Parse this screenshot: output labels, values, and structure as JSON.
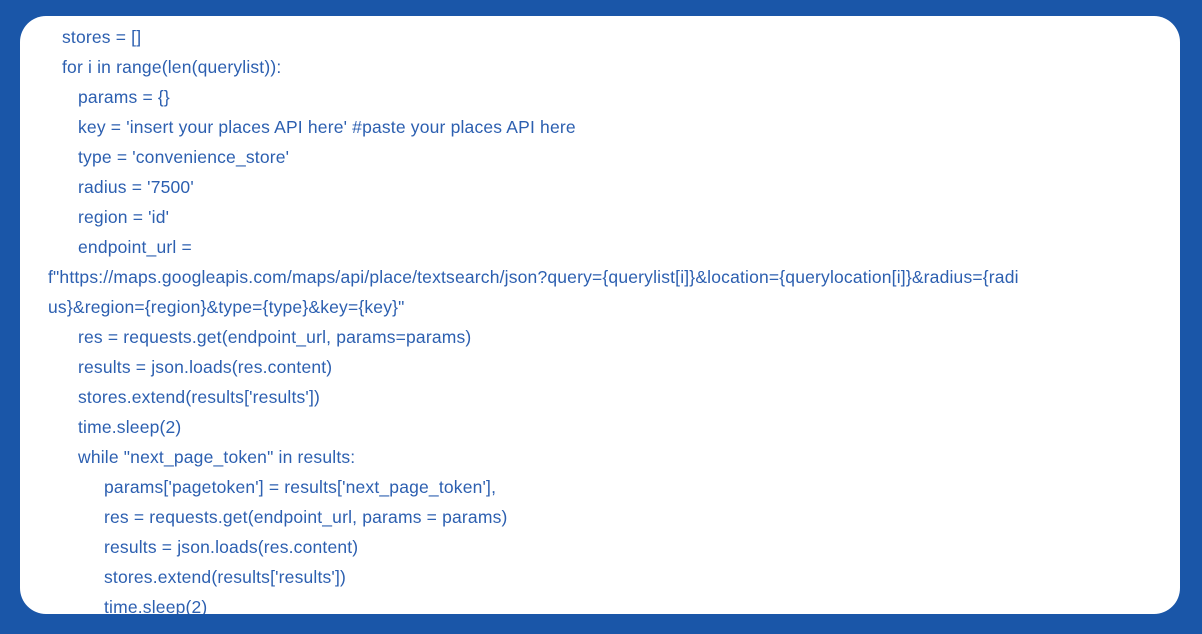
{
  "panel": {
    "background_color": "#ffffff",
    "frame_color": "#1a56a8",
    "text_color": "#2c5fb0",
    "language": "python"
  },
  "code": {
    "lines": [
      {
        "text": "stores = []",
        "indent": 0
      },
      {
        "text": "for i in range(len(querylist)):",
        "indent": 0
      },
      {
        "text": "params = {}",
        "indent": 1
      },
      {
        "text": "key = 'insert your places API here' #paste your places API here",
        "indent": 1
      },
      {
        "text": "type = 'convenience_store'",
        "indent": 1
      },
      {
        "text": "radius = '7500'",
        "indent": 1
      },
      {
        "text": "region = 'id'",
        "indent": 1
      },
      {
        "text": "endpoint_url =",
        "indent": 1
      },
      {
        "text": "f\"https://maps.googleapis.com/maps/api/place/textsearch/json?query={querylist[i]}&location={querylocation[i]}&radius={radi",
        "indent": "wrap"
      },
      {
        "text": "us}&region={region}&type={type}&key={key}\"",
        "indent": "wrap"
      },
      {
        "text": "res = requests.get(endpoint_url, params=params)",
        "indent": 1
      },
      {
        "text": "results = json.loads(res.content)",
        "indent": 1
      },
      {
        "text": "stores.extend(results['results'])",
        "indent": 1
      },
      {
        "text": "time.sleep(2)",
        "indent": 1
      },
      {
        "text": "while \"next_page_token\" in results:",
        "indent": 1
      },
      {
        "text": "params['pagetoken'] = results['next_page_token'],",
        "indent": 2
      },
      {
        "text": "res = requests.get(endpoint_url, params = params)",
        "indent": 2
      },
      {
        "text": "results = json.loads(res.content)",
        "indent": 2
      },
      {
        "text": "stores.extend(results['results'])",
        "indent": 2
      },
      {
        "text": "time.sleep(2)",
        "indent": 2
      }
    ]
  }
}
